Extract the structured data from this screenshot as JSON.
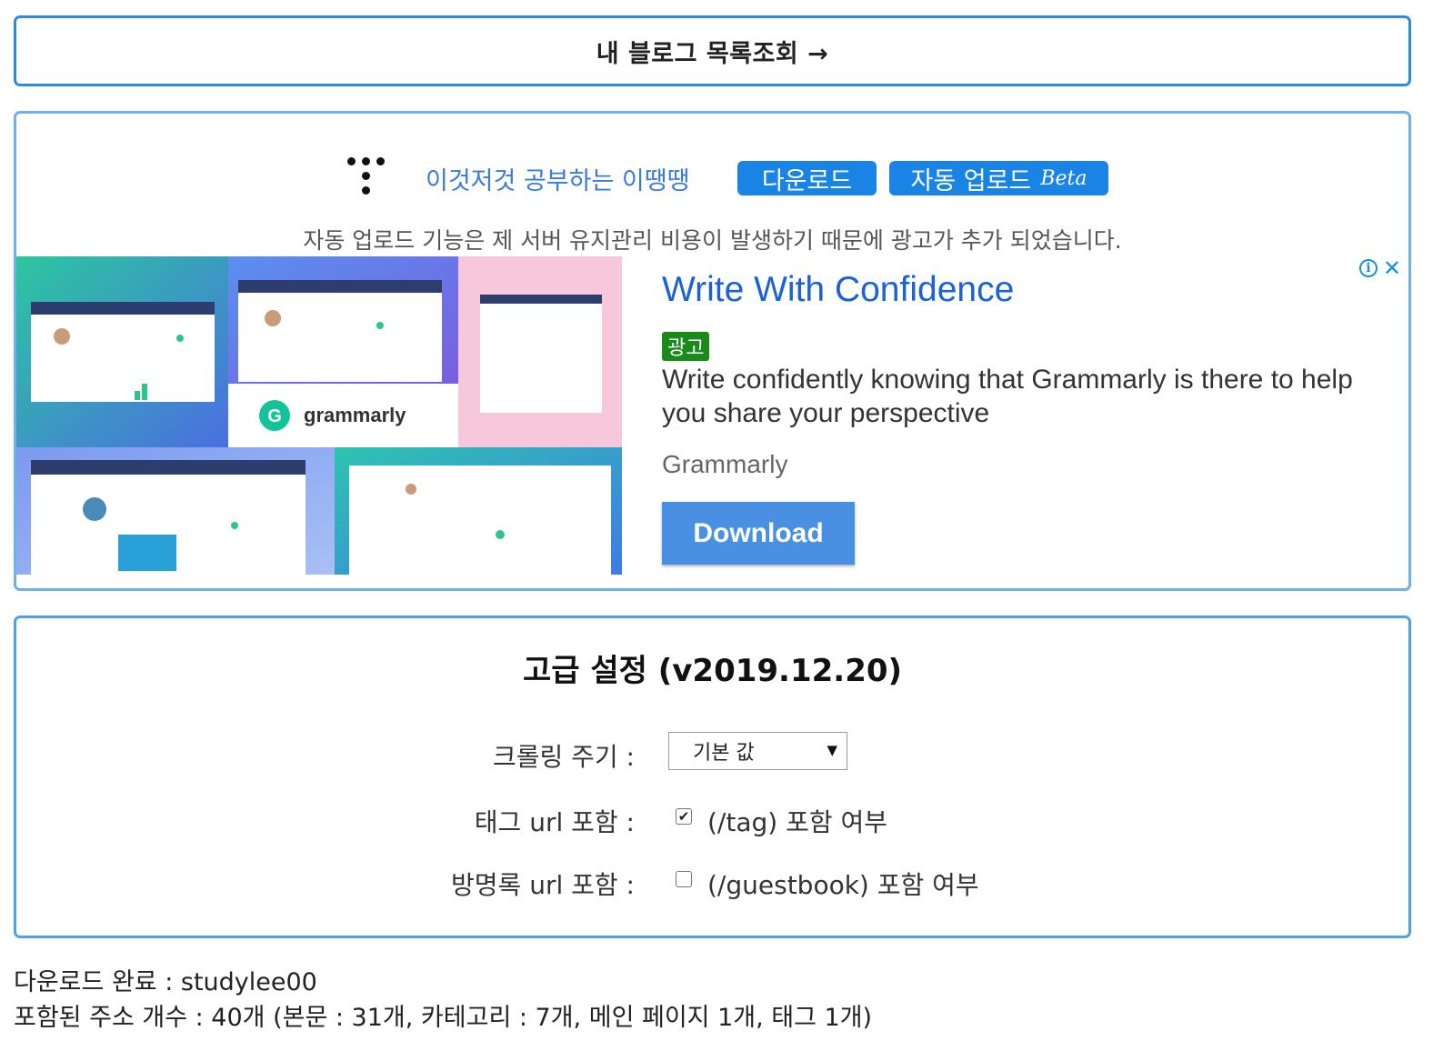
{
  "top_button": {
    "label": "내 블로그 목록조회 →"
  },
  "blog": {
    "title": "이것저것 공부하는 이땡땡",
    "download_label": "다운로드",
    "auto_upload_label": "자동 업로드",
    "beta_label": "Beta",
    "notice": "자동 업로드 기능은 제 서버 유지관리 비용이 발생하기 때문에 광고가 추가 되었습니다."
  },
  "ad": {
    "headline": "Write With Confidence",
    "badge": "광고",
    "body": "Write confidently knowing that Grammarly is there to help you share your perspective",
    "brand": "Grammarly",
    "cta": "Download",
    "image_brand": "grammarly",
    "colors": {
      "accent": "#4a90e2",
      "headline": "#1a62d6",
      "badge": "#1a8a1a"
    }
  },
  "settings": {
    "title": "고급 설정 (v2019.12.20)",
    "crawl_label": "크롤링 주기 :",
    "crawl_value": "기본 값",
    "tag_label": "태그 url 포함 :",
    "tag_checked": true,
    "tag_desc": "(/tag) 포함 여부",
    "guestbook_label": "방명록 url 포함 :",
    "guestbook_checked": false,
    "guestbook_desc": "(/guestbook) 포함 여부"
  },
  "status": {
    "done": "다운로드 완료 : studylee00",
    "count": "포함된 주소 개수 : 40개 (본문 : 31개, 카테고리 : 7개, 메인 페이지 1개, 태그 1개)"
  },
  "colors": {
    "border": "#2b8be0",
    "pill": "#1a84e6",
    "blog_title": "#3a7ad8"
  }
}
